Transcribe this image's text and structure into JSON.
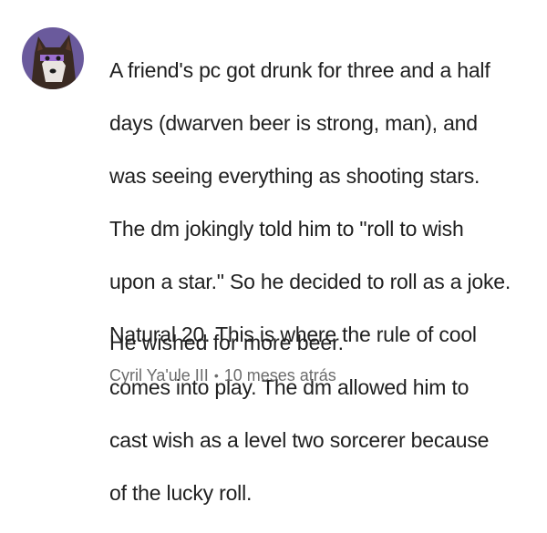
{
  "comment": {
    "avatar_icon": "wolf-avatar-icon",
    "body_lines": [
      "A friend's pc got drunk for three and a half",
      "days (dwarven beer is strong, man), and",
      "was seeing everything as shooting stars.",
      "The dm jokingly told him to \"roll to wish",
      "upon a star.\" So he decided to roll as a joke.",
      "Natural 20. This is where the rule of cool",
      "comes into play. The dm allowed him to",
      "cast wish as a level two sorcerer because",
      "of the lucky roll."
    ],
    "punchline": "He wished for more beer.",
    "author": "Cyril Ya'ule III",
    "separator": "•",
    "timestamp": "10 meses atrás"
  },
  "colors": {
    "avatar_bg": "#6a5a9c",
    "text": "#202020",
    "meta": "#6b6b6b"
  }
}
